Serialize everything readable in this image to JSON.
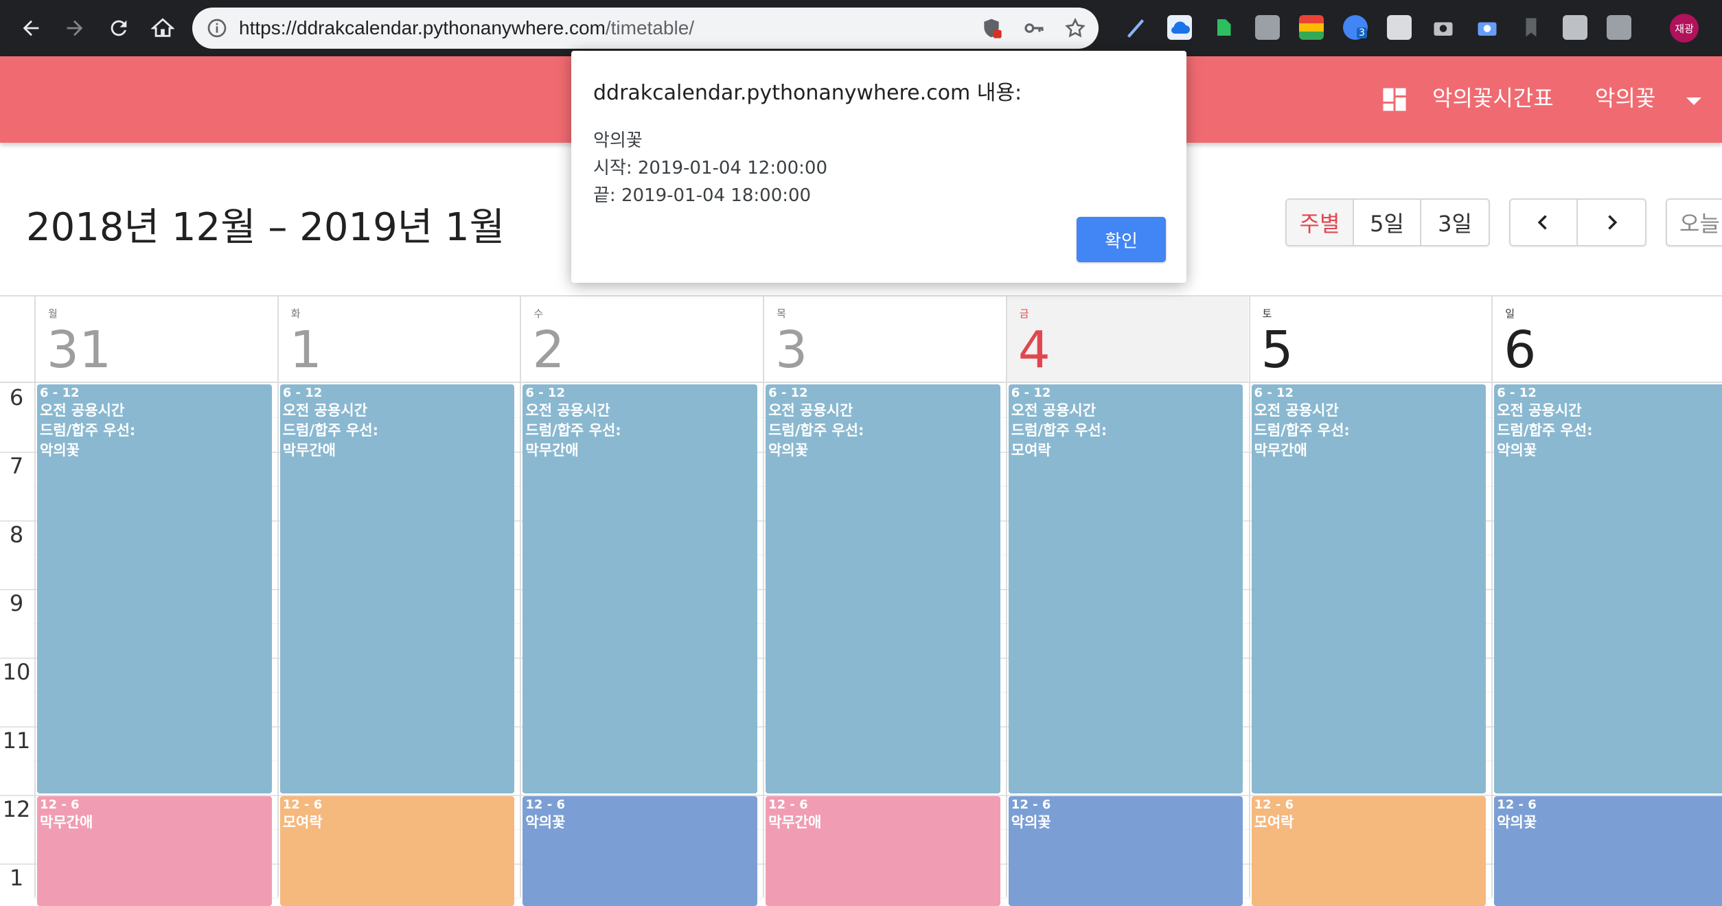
{
  "browser": {
    "url_host": "https://ddrakcalendar.pythonanywhere.com",
    "url_path": "/timetable/",
    "profile_label": "재광",
    "extension_badge": "3"
  },
  "app": {
    "brand_title": "악의꽃시간표",
    "user_menu_label": "악의꽃"
  },
  "toolbar": {
    "range_title": "2018년 12월 – 2019년 1월",
    "view_buttons": [
      "주별",
      "5일",
      "3일"
    ],
    "active_view": "주별",
    "today_label": "오늘"
  },
  "colors": {
    "header": "#f06b71",
    "event_blue": "#8ab8d0",
    "event_pink": "#f09db3",
    "event_orange": "#f5b87d",
    "event_indigo": "#7b9fd4",
    "today_accent": "#e0474f"
  },
  "calendar": {
    "hour_labels": [
      "6",
      "7",
      "8",
      "9",
      "10",
      "11",
      "12",
      "1"
    ],
    "days": [
      {
        "dow": "월",
        "num": "31"
      },
      {
        "dow": "화",
        "num": "1"
      },
      {
        "dow": "수",
        "num": "2"
      },
      {
        "dow": "목",
        "num": "3"
      },
      {
        "dow": "금",
        "num": "4"
      },
      {
        "dow": "토",
        "num": "5"
      },
      {
        "dow": "일",
        "num": "6"
      }
    ],
    "events": [
      {
        "day": 0,
        "time": "6 - 12",
        "title": "오전 공용시간\n드럼/합주 우선:\n악의꽃",
        "color": "blue"
      },
      {
        "day": 1,
        "time": "6 - 12",
        "title": "오전 공용시간\n드럼/합주 우선:\n막무간애",
        "color": "blue"
      },
      {
        "day": 2,
        "time": "6 - 12",
        "title": "오전 공용시간\n드럼/합주 우선:\n막무간애",
        "color": "blue"
      },
      {
        "day": 3,
        "time": "6 - 12",
        "title": "오전 공용시간\n드럼/합주 우선:\n악의꽃",
        "color": "blue"
      },
      {
        "day": 4,
        "time": "6 - 12",
        "title": "오전 공용시간\n드럼/합주 우선:\n모여락",
        "color": "blue"
      },
      {
        "day": 5,
        "time": "6 - 12",
        "title": "오전 공용시간\n드럼/합주 우선:\n막무간애",
        "color": "blue"
      },
      {
        "day": 6,
        "time": "6 - 12",
        "title": "오전 공용시간\n드럼/합주 우선:\n악의꽃",
        "color": "blue"
      },
      {
        "day": 0,
        "time": "12 - 6",
        "title": "막무간애",
        "color": "pink"
      },
      {
        "day": 1,
        "time": "12 - 6",
        "title": "모여락",
        "color": "orange"
      },
      {
        "day": 2,
        "time": "12 - 6",
        "title": "악의꽃",
        "color": "indigo"
      },
      {
        "day": 3,
        "time": "12 - 6",
        "title": "막무간애",
        "color": "pink"
      },
      {
        "day": 4,
        "time": "12 - 6",
        "title": "악의꽃",
        "color": "indigo"
      },
      {
        "day": 5,
        "time": "12 - 6",
        "title": "모여락",
        "color": "orange"
      },
      {
        "day": 6,
        "time": "12 - 6",
        "title": "악의꽃",
        "color": "indigo"
      }
    ]
  },
  "dialog": {
    "title": "ddrakcalendar.pythonanywhere.com 내용:",
    "lines": [
      "악의꽃",
      "시작: 2019-01-04 12:00:00",
      "끝: 2019-01-04 18:00:00"
    ],
    "ok_label": "확인"
  }
}
